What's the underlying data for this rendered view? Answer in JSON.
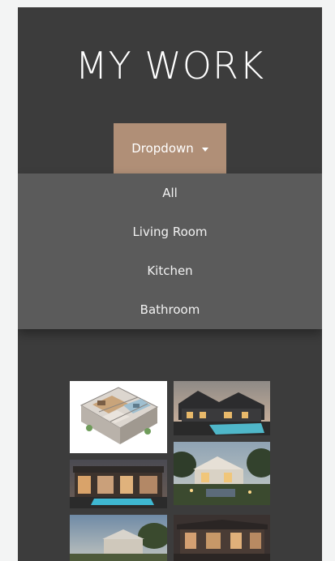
{
  "header": {
    "title": "MY WORK"
  },
  "dropdown": {
    "label": "Dropdown",
    "items": [
      {
        "label": "All"
      },
      {
        "label": "Living Room"
      },
      {
        "label": "Kitchen"
      },
      {
        "label": "Bathroom"
      }
    ]
  },
  "gallery": {
    "images": [
      {
        "name": "floor-plan-image",
        "desc": "3D floor plan"
      },
      {
        "name": "house-pool-image",
        "desc": "dark house exterior with pool"
      },
      {
        "name": "house-night-image",
        "desc": "house at dusk with pool"
      },
      {
        "name": "garden-house-image",
        "desc": "house with lit garden"
      },
      {
        "name": "house-hill-image",
        "desc": "house exterior on hill"
      },
      {
        "name": "house-terrace-image",
        "desc": "house terrace at dusk"
      }
    ]
  }
}
